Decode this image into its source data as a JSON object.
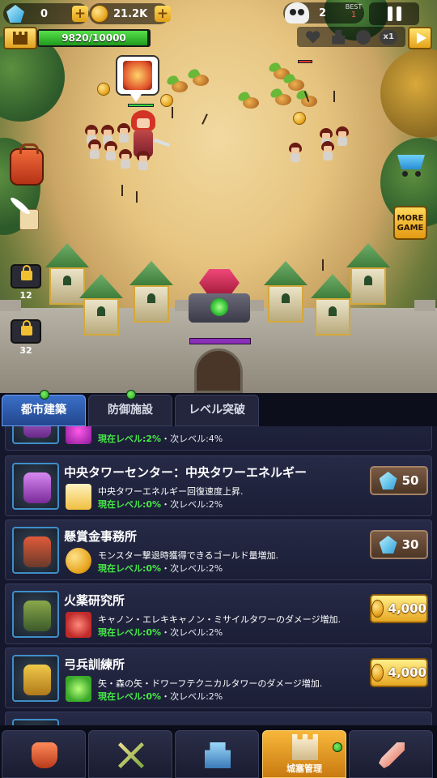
{
  "hud": {
    "gems": "0",
    "gold": "21.2K",
    "kills": "2",
    "best_label": "BEST",
    "best_value": "1",
    "castle_hp": "9820/10000",
    "castle_hp_fraction": 0.982,
    "speed_label": "x1",
    "more_game": "MORE GAME"
  },
  "side": {
    "lock_slots": [
      "12",
      "32"
    ]
  },
  "tabs": [
    {
      "label": "都市建築",
      "active": true,
      "badge": true
    },
    {
      "label": "防御施設",
      "active": false,
      "badge": true
    },
    {
      "label": "レベル突破",
      "active": false,
      "badge": false
    }
  ],
  "buildings": [
    {
      "name": "",
      "desc": "",
      "level_current": "現在レベル:2%",
      "level_next": "・次レベル:4%",
      "cost": "",
      "currency": "none"
    },
    {
      "name": "中央タワーセンター：中央タワーエネルギー",
      "desc": "中央タワーエネルギー回復速度上昇.",
      "level_current": "現在レベル:0%",
      "level_next": "・次レベル:2%",
      "cost": "50",
      "currency": "gem"
    },
    {
      "name": "懸賞金事務所",
      "desc": "モンスター撃退時獲得できるゴールド量増加.",
      "level_current": "現在レベル:0%",
      "level_next": "・次レベル:2%",
      "cost": "30",
      "currency": "gem"
    },
    {
      "name": "火薬研究所",
      "desc": "キャノン・エレキキャノン・ミサイルタワーのダメージ増加.",
      "level_current": "現在レベル:0%",
      "level_next": "・次レベル:2%",
      "cost": "4,000",
      "currency": "gold"
    },
    {
      "name": "弓兵訓練所",
      "desc": "矢・森の矢・ドワーフテクニカルタワーのダメージ増加.",
      "level_current": "現在レベル:0%",
      "level_next": "・次レベル:2%",
      "cost": "4,000",
      "currency": "gold"
    }
  ],
  "nav": [
    {
      "icon": "armor-icon",
      "label": "",
      "active": false
    },
    {
      "icon": "crossed-swords-icon",
      "label": "",
      "active": false
    },
    {
      "icon": "defense-tower-icon",
      "label": "",
      "active": false
    },
    {
      "icon": "castle-icon",
      "label": "城塞管理",
      "active": true,
      "badge": true
    },
    {
      "icon": "rocket-icon",
      "label": "",
      "active": false
    }
  ],
  "colors": {
    "tab_active": "#3a6fc8",
    "level_current": "#48e84a",
    "gold": "#e6a622",
    "hp_bar": "#3bd43b",
    "nav_active": "#f7b73a"
  }
}
